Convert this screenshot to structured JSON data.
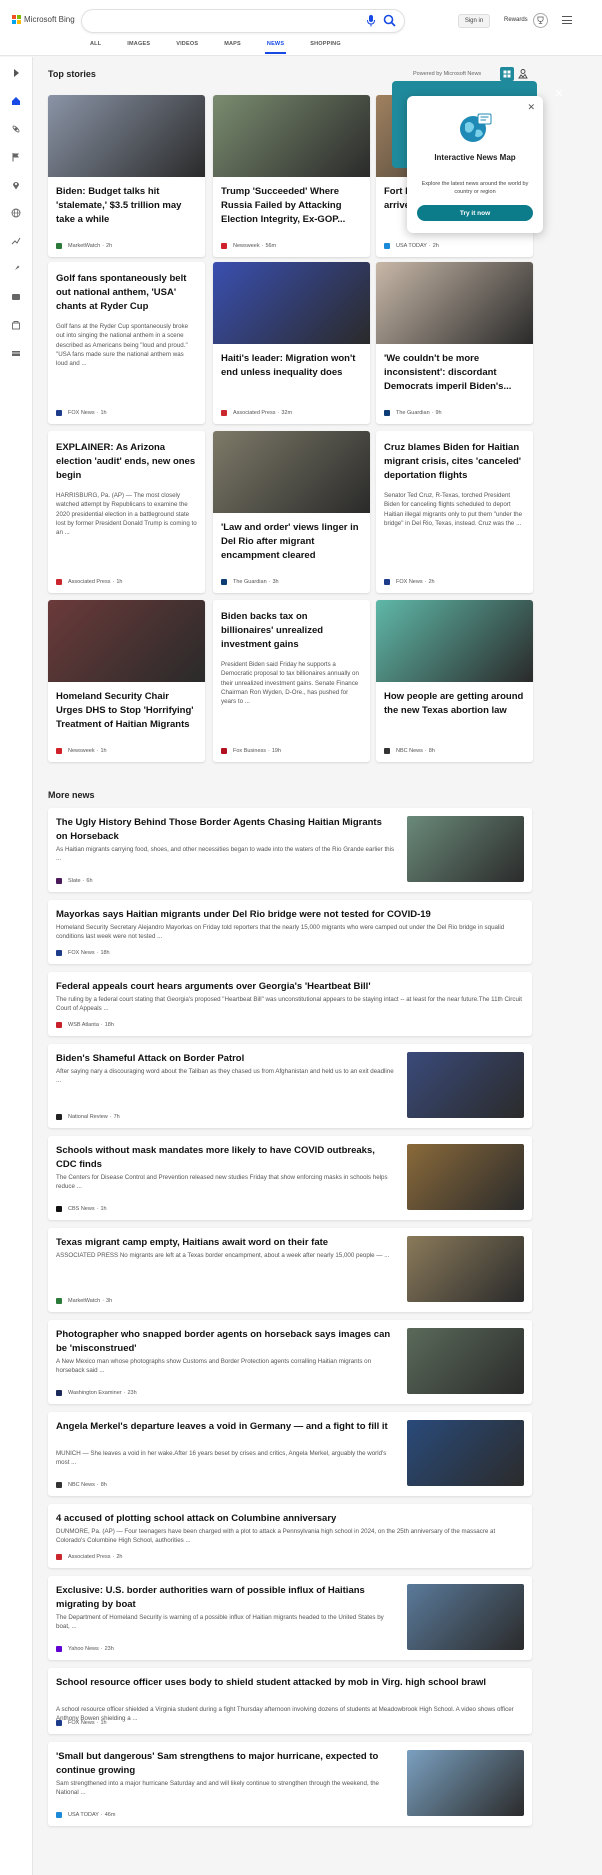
{
  "header": {
    "brand": "Microsoft Bing",
    "search_value": "",
    "signin": "Sign in",
    "rewards": "Rewards",
    "tabs": [
      "ALL",
      "IMAGES",
      "VIDEOS",
      "MAPS",
      "NEWS",
      "SHOPPING"
    ],
    "active_tab": "NEWS"
  },
  "rail_icons": [
    "expand-icon",
    "home-icon",
    "science-icon",
    "flag-icon",
    "location-icon",
    "globe-icon",
    "business-icon",
    "rocket-icon",
    "entertainment-icon",
    "sports-icon",
    "money-icon"
  ],
  "top_stories": {
    "title": "Top stories",
    "powered_by": "Powered by Microsoft News",
    "cards": [
      {
        "title": "Biden: Budget talks hit 'stalemate,' $3.5 trillion may take a while",
        "snippet": "",
        "source": "MarketWatch",
        "time": "2h",
        "img_color": "#8a94a6"
      },
      {
        "title": "Trump 'Succeeded' Where Russia Failed by Attacking Election Integrity, Ex-GOP...",
        "snippet": "",
        "source": "Newsweek",
        "time": "56m",
        "img_color": "#7a8c6f"
      },
      {
        "title": "Fort Hood servicemembers arrive in Afghan...",
        "snippet": "",
        "source": "USA TODAY",
        "time": "2h",
        "img_color": "#a0815f"
      },
      {
        "title": "Golf fans spontaneously belt out national anthem, 'USA' chants at Ryder Cup",
        "snippet": "Golf fans at the Ryder Cup spontaneously broke out into singing the national anthem in a scene described as Americans being \"loud and proud.\" \"USA fans made sure the national anthem was loud and ...",
        "source": "FOX News",
        "time": "1h",
        "img_color": ""
      },
      {
        "title": "Haiti's leader: Migration won't end unless inequality does",
        "snippet": "",
        "source": "Associated Press",
        "time": "32m",
        "img_color": "#3a4fb0"
      },
      {
        "title": "'We couldn't be more inconsistent': discordant Democrats imperil Biden's...",
        "snippet": "",
        "source": "The Guardian",
        "time": "9h",
        "img_color": "#c8b8a8"
      },
      {
        "title": "EXPLAINER: As Arizona election 'audit' ends, new ones begin",
        "snippet": "HARRISBURG, Pa. (AP) — The most closely watched attempt by Republicans to examine the 2020 presidential election in a battleground state lost by former President Donald Trump is coming to an ...",
        "source": "Associated Press",
        "time": "1h",
        "img_color": ""
      },
      {
        "title": "'Law and order' views linger in Del Rio after migrant encampment cleared",
        "snippet": "",
        "source": "The Guardian",
        "time": "3h",
        "img_color": "#7d7a68"
      },
      {
        "title": "Cruz blames Biden for Haitian migrant crisis, cites 'canceled' deportation flights",
        "snippet": "Senator Ted Cruz, R-Texas, torched President Biden for canceling flights scheduled to deport Haitian illegal migrants only to put them \"under the bridge\" in Del Rio, Texas, instead. Cruz was the ...",
        "source": "FOX News",
        "time": "2h",
        "img_color": ""
      },
      {
        "title": "Homeland Security Chair Urges DHS to Stop 'Horrifying' Treatment of Haitian Migrants",
        "snippet": "",
        "source": "Newsweek",
        "time": "1h",
        "img_color": "#6b3a3a"
      },
      {
        "title": "Biden backs tax on billionaires' unrealized investment gains",
        "snippet": "President Biden said Friday he supports a Democratic proposal to tax billionaires annually on their unrealized investment gains. Senate Finance Chairman Ron Wyden, D-Ore., has pushed for years to ...",
        "source": "Fox Business",
        "time": "19h",
        "img_color": ""
      },
      {
        "title": "How people are getting around the new Texas abortion law",
        "snippet": "",
        "source": "NBC News",
        "time": "8h",
        "img_color": "#5fb8a8"
      }
    ]
  },
  "popup": {
    "title": "Interactive News Map",
    "description": "Explore the latest news around the world by country or region",
    "button": "Try it now"
  },
  "more_news": {
    "title": "More news",
    "items": [
      {
        "title": "The Ugly History Behind Those Border Agents Chasing Haitian Migrants on Horseback",
        "snippet": "As Haitian migrants carrying food, shoes, and other necessities began to wade into the waters of the Rio Grande earlier this ...",
        "source": "Slate",
        "time": "6h",
        "has_img": true,
        "img_color": "#6a8a7a"
      },
      {
        "title": "Mayorkas says Haitian migrants under Del Rio bridge were not tested for COVID-19",
        "snippet": "Homeland Security Secretary Alejandro Mayorkas on Friday told reporters that the nearly 15,000 migrants who were camped out under the Del Rio bridge in squalid conditions last week were not tested ...",
        "source": "FOX News",
        "time": "18h",
        "has_img": false,
        "img_color": ""
      },
      {
        "title": "Federal appeals court hears arguments over Georgia's 'Heartbeat Bill'",
        "snippet": "The ruling by a federal court stating that Georgia's proposed \"Heartbeat Bill\" was unconstitutional appears to be staying intact -- at least for the near future.The 11th Circuit Court of Appeals ...",
        "source": "WSB Atlanta",
        "time": "18h",
        "has_img": false,
        "img_color": ""
      },
      {
        "title": "Biden's Shameful Attack on Border Patrol",
        "snippet": "After saying nary a discouraging word about the Taliban as they chased us from Afghanistan and held us to an exit deadline ...",
        "source": "National Review",
        "time": "7h",
        "has_img": true,
        "img_color": "#3a4a7a"
      },
      {
        "title": "Schools without mask mandates more likely to have COVID outbreaks, CDC finds",
        "snippet": "The Centers for Disease Control and Prevention released new studies Friday that show enforcing masks in schools helps reduce ...",
        "source": "CBS News",
        "time": "1h",
        "has_img": true,
        "img_color": "#8a6a3a"
      },
      {
        "title": "Texas migrant camp empty, Haitians await word on their fate",
        "snippet": "ASSOCIATED PRESS No migrants are left at a Texas border encampment, about a week after nearly 15,000 people — ...",
        "source": "MarketWatch",
        "time": "3h",
        "has_img": true,
        "img_color": "#8a7a5a"
      },
      {
        "title": "Photographer who snapped border agents on horseback says images can be 'misconstrued'",
        "snippet": "A New Mexico man whose photographs show Customs and Border Protection agents corralling Haitian migrants on horseback said ...",
        "source": "Washington Examiner",
        "time": "23h",
        "has_img": true,
        "img_color": "#5a6a5a"
      },
      {
        "title": "Angela Merkel's departure leaves a void in Germany — and a fight to fill it",
        "snippet": "MUNICH — She leaves a void in her wake.After 16 years beset by crises and critics, Angela Merkel, arguably the world's most ...",
        "source": "NBC News",
        "time": "8h",
        "has_img": true,
        "img_color": "#2a4a7a"
      },
      {
        "title": "4 accused of plotting school attack on Columbine anniversary",
        "snippet": "DUNMORE, Pa. (AP) — Four teenagers have been charged with a plot to attack a Pennsylvania high school in 2024, on the 25th anniversary of the massacre at Colorado's Columbine High School, authorities ...",
        "source": "Associated Press",
        "time": "2h",
        "has_img": false,
        "img_color": ""
      },
      {
        "title": "Exclusive: U.S. border authorities warn of possible influx of Haitians migrating by boat",
        "snippet": "The Department of Homeland Security is warning of a possible influx of Haitian migrants headed to the United States by boat, ...",
        "source": "Yahoo News",
        "time": "23h",
        "has_img": true,
        "img_color": "#5a7a9a"
      },
      {
        "title": "School resource officer uses body to shield student attacked by mob in Virg. high school brawl",
        "snippet": "A school resource officer shielded a Virginia student during a fight Thursday afternoon involving dozens of students at Meadowbrook High School.  A video shows officer Anthony Bowen shielding a ...",
        "source": "FOX News",
        "time": "1h",
        "has_img": false,
        "img_color": ""
      },
      {
        "title": "'Small but dangerous' Sam strengthens to major hurricane, expected to continue growing",
        "snippet": "Sam strengthened into a major hurricane Saturday and and will likely continue to strengthen through the weekend, the National ...",
        "source": "USA TODAY",
        "time": "46m",
        "has_img": true,
        "img_color": "#7aa0c0"
      }
    ]
  },
  "colors": {
    "accent": "#174ae4",
    "teal": "#0d7c8a"
  }
}
